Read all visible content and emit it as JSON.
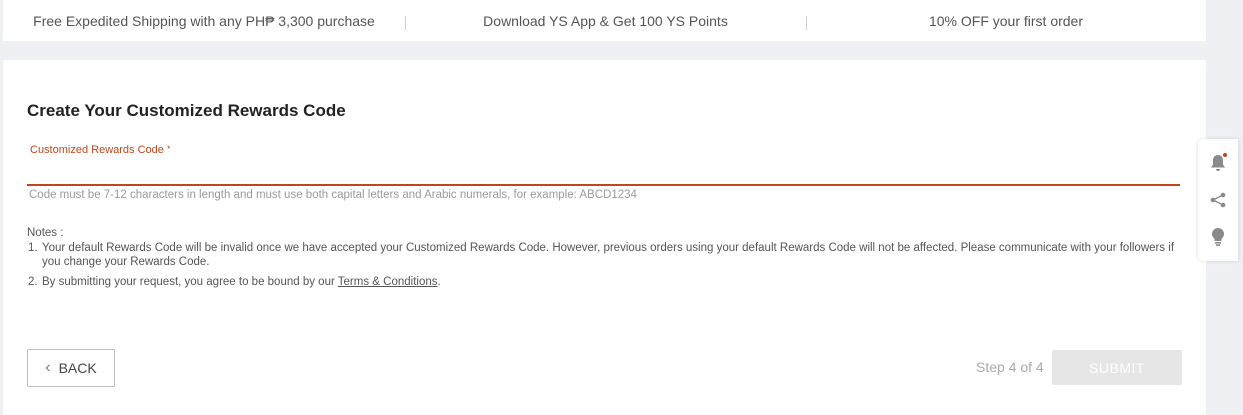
{
  "promo": {
    "items": [
      "Free Expedited Shipping with any PH₱ 3,300 purchase",
      "Download YS App & Get 100 YS Points",
      "10% OFF your first order"
    ]
  },
  "form": {
    "title": "Create Your Customized Rewards Code",
    "field_label": "Customized Rewards Code",
    "required_mark": "*",
    "input_value": "",
    "hint": "Code must be 7-12 characters in length and must use both capital letters and Arabic numerals, for example: ABCD1234"
  },
  "notes": {
    "heading": "Notes :",
    "items": [
      {
        "num": "1.",
        "text": "Your default Rewards Code will be invalid once we have accepted your Customized Rewards Code. However, previous orders using your default Rewards Code will not be affected. Please communicate with your followers if you change your Rewards Code."
      },
      {
        "num": "2.",
        "text_before": "By submitting your request, you agree to be bound by our ",
        "link": "Terms & Conditions",
        "text_after": "."
      }
    ]
  },
  "footer": {
    "back_label": "BACK",
    "step_label": "Step 4 of 4",
    "submit_label": "SUBMIT"
  },
  "side_tools": {
    "icons": [
      "bell-icon",
      "share-icon",
      "lightbulb-icon"
    ]
  },
  "colors": {
    "accent": "#c0471c",
    "submit_disabled": "#e6e6e6"
  }
}
